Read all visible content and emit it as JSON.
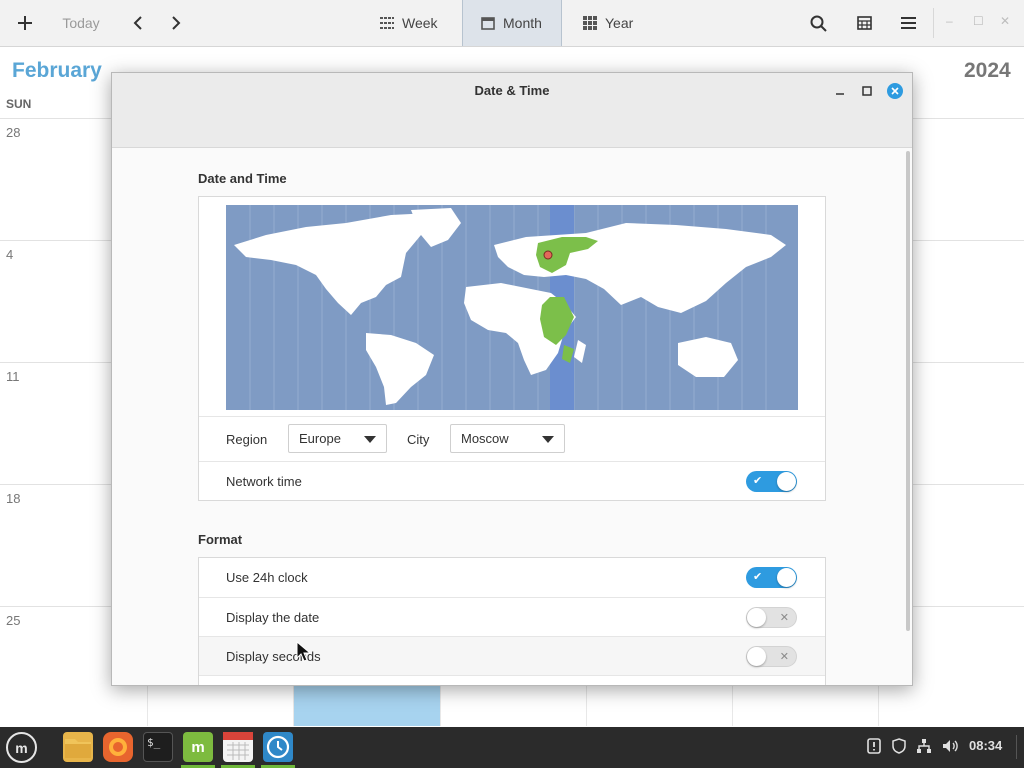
{
  "calendar": {
    "toolbar": {
      "today_label": "Today",
      "views": [
        "Week",
        "Month",
        "Year"
      ],
      "active_view": "Month"
    },
    "month_title": "February",
    "year_title": "2024",
    "weekday_header": "SUN",
    "week_starts": [
      "28",
      "4",
      "11",
      "18",
      "25"
    ]
  },
  "dialog": {
    "title": "Date & Time",
    "section_date_time": "Date and Time",
    "region_label": "Region",
    "region_value": "Europe",
    "city_label": "City",
    "city_value": "Moscow",
    "network_time_label": "Network time",
    "network_time_on": true,
    "section_format": "Format",
    "use_24h_label": "Use 24h clock",
    "use_24h_on": true,
    "display_date_label": "Display the date",
    "display_date_on": false,
    "display_seconds_label": "Display seconds",
    "display_seconds_on": false
  },
  "taskbar": {
    "apps": [
      "menu-icon",
      "files-icon",
      "firefox-icon",
      "terminal-icon",
      "mintinstall-icon",
      "calendar-icon",
      "clock-icon"
    ],
    "clock": "08:34"
  },
  "colors": {
    "accent": "#2e9be0",
    "map_ocean": "#7f9bc4",
    "map_land": "#ffffff",
    "timezone_highlight": "#7cbf4a",
    "month_title": "#5aa6d6"
  }
}
